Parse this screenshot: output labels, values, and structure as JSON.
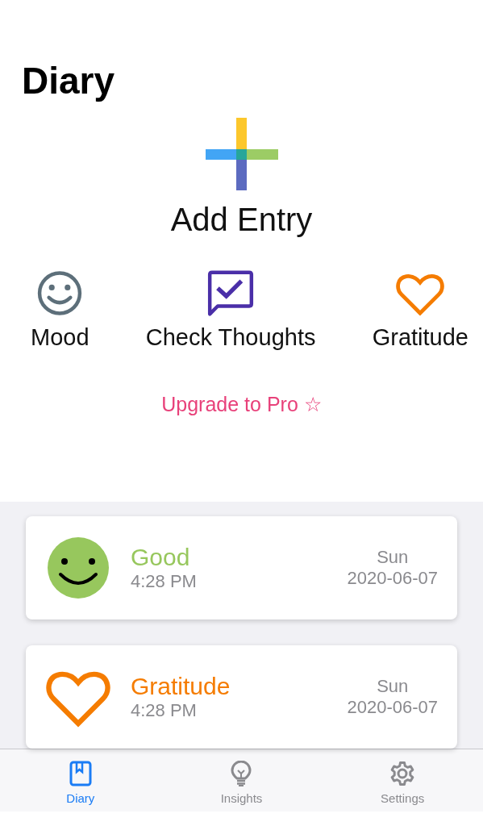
{
  "title": "Diary",
  "add_entry": {
    "label": "Add Entry"
  },
  "actions": [
    {
      "kind": "mood",
      "label": "Mood"
    },
    {
      "kind": "thoughts",
      "label": "Check Thoughts"
    },
    {
      "kind": "gratitude",
      "label": "Gratitude"
    }
  ],
  "upgrade": {
    "label": "Upgrade to Pro ☆"
  },
  "entries": [
    {
      "kind": "mood",
      "title": "Good",
      "color": "#97c75d",
      "time": "4:28 PM",
      "weekday": "Sun",
      "date": "2020-06-07"
    },
    {
      "kind": "gratitude",
      "title": "Gratitude",
      "color": "#f57c00",
      "time": "4:28 PM",
      "weekday": "Sun",
      "date": "2020-06-07"
    }
  ],
  "tabs": [
    {
      "kind": "diary",
      "label": "Diary",
      "selected": true
    },
    {
      "kind": "insights",
      "label": "Insights",
      "selected": false
    },
    {
      "kind": "settings",
      "label": "Settings",
      "selected": false
    }
  ]
}
